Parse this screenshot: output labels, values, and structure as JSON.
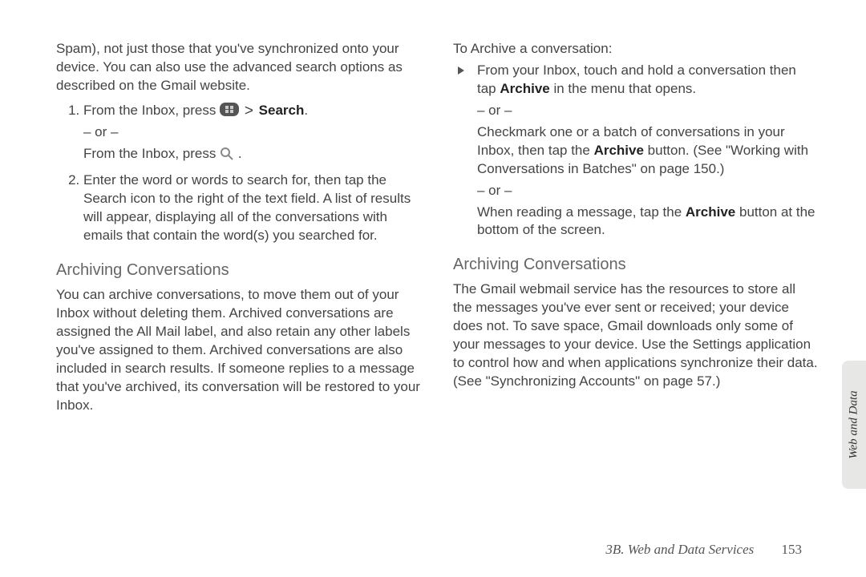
{
  "left": {
    "intro": "Spam), not just those that you've synchronized onto your device. You can also use the advanced search options as described on the Gmail website.",
    "step1a": "From the Inbox, press ",
    "step1_search": "Search",
    "step1_or": "– or –",
    "step1b_pre": "From the Inbox, press ",
    "step1b_post": " .",
    "step2": "Enter the word or words to search for, then tap the Search icon to the right of the text field. A list of results will appear, displaying all of the conversations with emails that contain the word(s) you searched for.",
    "heading": "Archiving Conversations",
    "archive_body": "You can archive conversations, to move them out of your Inbox without deleting them. Archived conversations are assigned the All Mail label, and also retain any other labels you've assigned to them. Archived conversations are also included in search results. If someone replies to a message that you've archived, its conversation will be restored to your Inbox."
  },
  "right": {
    "to_archive": "To Archive a conversation:",
    "b1a": "From your Inbox, touch and hold a conversation then tap ",
    "b1_bold": "Archive",
    "b1b": " in the menu that opens.",
    "or": "– or –",
    "b2a": "Checkmark one or a batch of conversations in your Inbox, then tap the ",
    "b2_bold": "Archive",
    "b2b": " button. (See \"Working with Conversations in Batches\" on page 150.)",
    "b3a": "When reading a message, tap the ",
    "b3_bold": "Archive",
    "b3b": " button at the bottom of the screen.",
    "heading": "Archiving Conversations",
    "body": "The Gmail webmail service has the resources to store all the messages you've ever sent or received; your device does not. To save space, Gmail downloads only some of your messages to your device. Use the Settings application to control how and when applications synchronize their data. (See \"Synchronizing Accounts\" on page 57.)"
  },
  "side_tab": "Web and Data",
  "footer_section": "3B. Web and Data Services",
  "footer_page": "153"
}
